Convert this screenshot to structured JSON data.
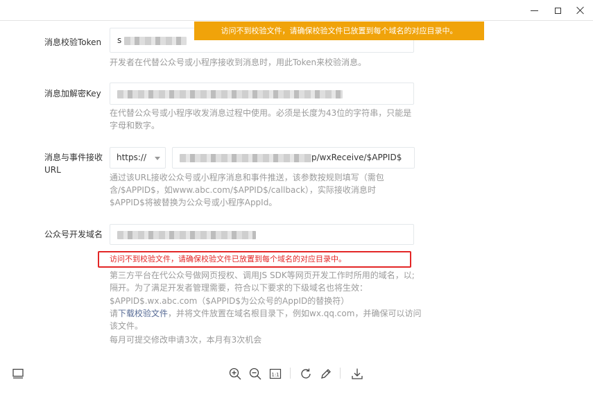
{
  "window": {
    "controls": [
      "minimize",
      "maximize",
      "close"
    ]
  },
  "toast": {
    "message": "访问不到校验文件，请确保校验文件已放置到每个域名的对应目录中。",
    "color": "#f0a30a"
  },
  "form": {
    "token": {
      "label": "消息校验Token",
      "value_prefix": "s",
      "hint": "开发者在代替公众号或小程序接收到消息时，用此Token来校验消息。"
    },
    "encrypt_key": {
      "label": "消息加解密Key",
      "hint_line1": "在代替公众号或小程序收发消息过程中使用。必须是长度为43位的字符串，只能是",
      "hint_line2": "字母和数字。"
    },
    "event_url": {
      "label_line1": "消息与事件接收",
      "label_line2": "URL",
      "protocol": "https://",
      "url_suffix": "p/wxReceive/$APPID$",
      "hint_line1": "通过该URL接收公众号或小程序消息和事件推送，该参数按规则填写（需包",
      "hint_line2": "含/$APPID$，如www.abc.com/$APPID$/callback），实际接收消息时",
      "hint_line3": "$APPID$将被替换为公众号或小程序AppId。"
    },
    "dev_domain": {
      "label": "公众号开发域名",
      "error": "访问不到校验文件，请确保校验文件已放置到每个域名的对应目录中。",
      "error_color": "#e32626",
      "hint_line1": "第三方平台在代公众号做网页授权、调用JS SDK等网页开发工作时所用的域名，以;",
      "hint_line2": "隔开。为了满足开发者管理需要，符合以下要求的下级域名也将生效：",
      "hint_line3": "$APPID$.wx.abc.com（$APPID$为公众号的AppID的替换符）",
      "hint_line4_pre": "请",
      "hint_line4_link": "下载校验文件",
      "hint_line4_post": "，并将文件放置在域名根目录下，例如wx.qq.com，并确保可以访问",
      "hint_line5": "该文件。",
      "hint_line6": "每月可提交修改申请3次，本月有3次机会"
    }
  },
  "toolbar": {
    "icons": [
      "sidebar-icon",
      "zoom-in-icon",
      "zoom-out-icon",
      "actual-size-icon",
      "rotate-icon",
      "edit-icon",
      "download-icon"
    ],
    "actual_size_label": "1:1"
  }
}
